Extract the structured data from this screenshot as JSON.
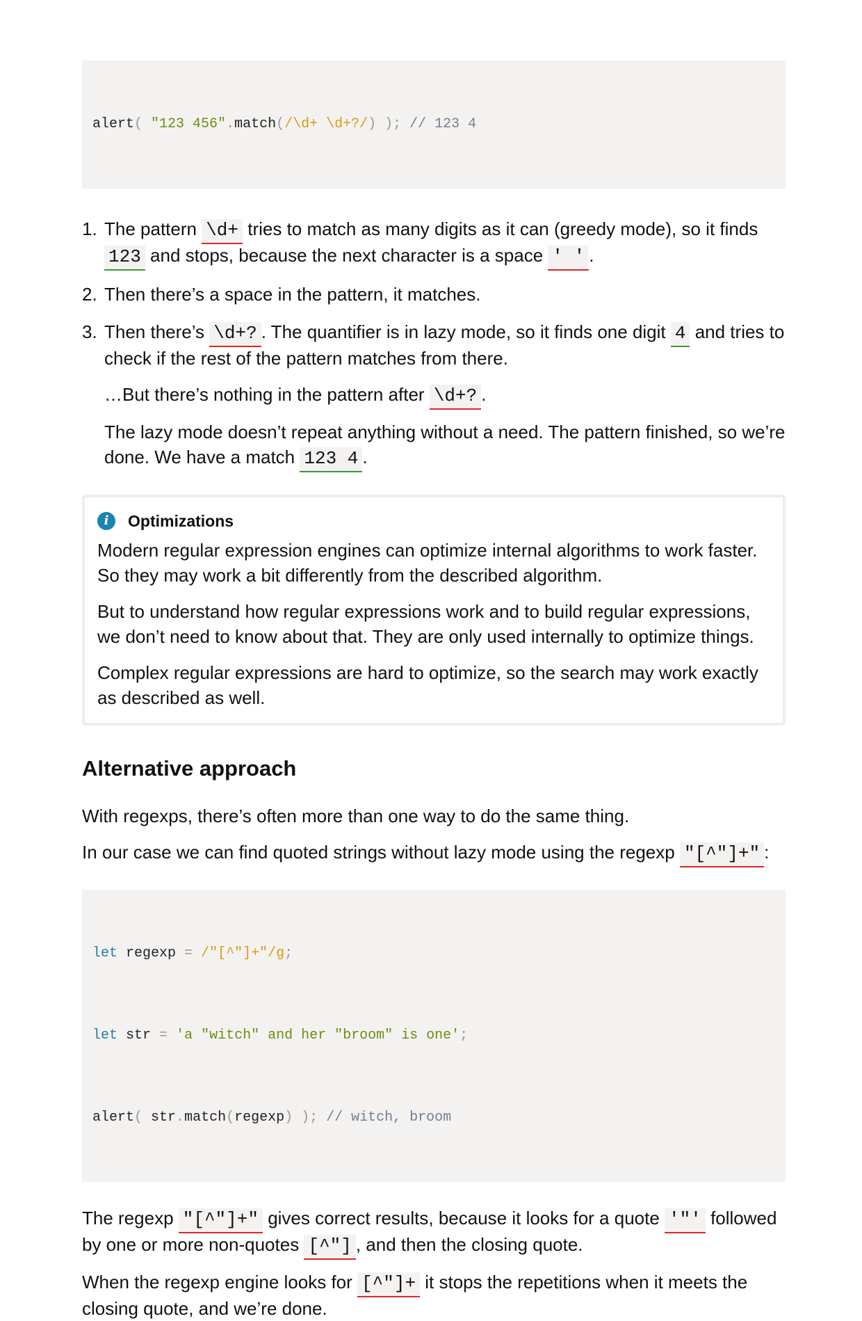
{
  "code1": {
    "tokens": [
      {
        "t": "alert",
        "c": "plain"
      },
      {
        "t": "( ",
        "c": "punc"
      },
      {
        "t": "\"123 456\"",
        "c": "string"
      },
      {
        "t": ".",
        "c": "punc"
      },
      {
        "t": "match",
        "c": "plain"
      },
      {
        "t": "(",
        "c": "punc"
      },
      {
        "t": "/\\d+ \\d+?/",
        "c": "regex"
      },
      {
        "t": ") ); ",
        "c": "punc"
      },
      {
        "t": "// 123 4",
        "c": "comment"
      }
    ]
  },
  "steps": [
    {
      "num": "1.",
      "paras": [
        [
          {
            "text": "The pattern "
          },
          {
            "code": "\\d+",
            "u": "red"
          },
          {
            "text": " tries to match as many digits as it can (greedy mode), so it finds "
          },
          {
            "code": "123",
            "u": "green"
          },
          {
            "text": " and stops, because the next character is a space "
          },
          {
            "code": "' '",
            "u": "red"
          },
          {
            "text": "."
          }
        ]
      ]
    },
    {
      "num": "2.",
      "paras": [
        [
          {
            "text": "Then there’s a space in the pattern, it matches."
          }
        ]
      ]
    },
    {
      "num": "3.",
      "paras": [
        [
          {
            "text": "Then there’s "
          },
          {
            "code": "\\d+?",
            "u": "red"
          },
          {
            "text": ". The quantifier is in lazy mode, so it finds one digit "
          },
          {
            "code": "4",
            "u": "green"
          },
          {
            "text": " and tries to check if the rest of the pattern matches from there."
          }
        ],
        [
          {
            "text": "…But there’s nothing in the pattern after "
          },
          {
            "code": "\\d+?",
            "u": "red"
          },
          {
            "text": "."
          }
        ],
        [
          {
            "text": "The lazy mode doesn’t repeat anything without a need. The pattern finished, so we’re done. We have a match "
          },
          {
            "code": "123 4",
            "u": "green"
          },
          {
            "text": "."
          }
        ]
      ]
    }
  ],
  "notice": {
    "icon": "info-icon",
    "icon_glyph": "i",
    "title": "Optimizations",
    "paragraphs": [
      "Modern regular expression engines can optimize internal algorithms to work faster. So they may work a bit differently from the described algorithm.",
      "But to understand how regular expressions work and to build regular expressions, we don’t need to know about that. They are only used internally to optimize things.",
      "Complex regular expressions are hard to optimize, so the search may work exactly as described as well."
    ]
  },
  "section": {
    "heading": "Alternative approach",
    "intro": "With regexps, there’s often more than one way to do the same thing.",
    "case_para": [
      {
        "text": "In our case we can find quoted strings without lazy mode using the regexp "
      },
      {
        "code": "\"[^\"]+\"",
        "u": "red"
      },
      {
        "text": ":"
      }
    ]
  },
  "code2": {
    "lines": [
      [
        {
          "t": "let",
          "c": "keyword"
        },
        {
          "t": " regexp ",
          "c": "plain"
        },
        {
          "t": "=",
          "c": "punc"
        },
        {
          "t": " ",
          "c": "plain"
        },
        {
          "t": "/\"[^\"]+\"/g",
          "c": "regex"
        },
        {
          "t": ";",
          "c": "punc"
        }
      ],
      [
        {
          "t": "let",
          "c": "keyword"
        },
        {
          "t": " str ",
          "c": "plain"
        },
        {
          "t": "=",
          "c": "punc"
        },
        {
          "t": " ",
          "c": "plain"
        },
        {
          "t": "'a \"witch\" and her \"broom\" is one'",
          "c": "string"
        },
        {
          "t": ";",
          "c": "punc"
        }
      ],
      [
        {
          "t": "alert",
          "c": "plain"
        },
        {
          "t": "( ",
          "c": "punc"
        },
        {
          "t": "str",
          "c": "plain"
        },
        {
          "t": ".",
          "c": "punc"
        },
        {
          "t": "match",
          "c": "plain"
        },
        {
          "t": "(",
          "c": "punc"
        },
        {
          "t": "regexp",
          "c": "plain"
        },
        {
          "t": ") ); ",
          "c": "punc"
        },
        {
          "t": "// witch, broom",
          "c": "comment"
        }
      ]
    ]
  },
  "closing": [
    [
      {
        "text": "The regexp "
      },
      {
        "code": "\"[^\"]+\"",
        "u": "red"
      },
      {
        "text": " gives correct results, because it looks for a quote "
      },
      {
        "code": "'\"'",
        "u": "red"
      },
      {
        "text": " followed by one or more non-quotes "
      },
      {
        "code": "[^\"]",
        "u": "red"
      },
      {
        "text": ", and then the closing quote."
      }
    ],
    [
      {
        "text": "When the regexp engine looks for "
      },
      {
        "code": "[^\"]+",
        "u": "red"
      },
      {
        "text": " it stops the repetitions when it meets the closing quote, and we’re done."
      }
    ]
  ]
}
